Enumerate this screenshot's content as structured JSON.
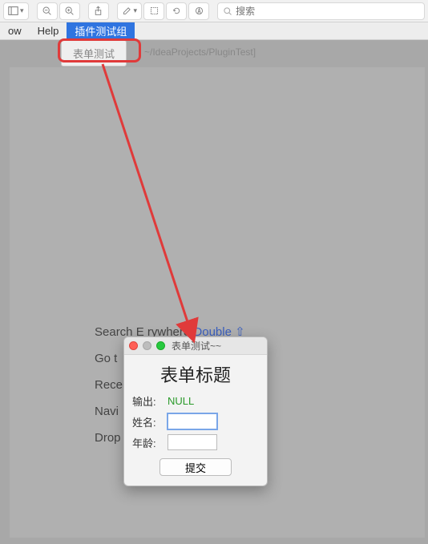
{
  "toolbar": {
    "search_placeholder": "搜索"
  },
  "menubar": {
    "items": [
      "ow",
      "Help",
      "插件测试组"
    ]
  },
  "submenu": {
    "label": "表单测试"
  },
  "pathbar": "~/IdeaProjects/PluginTest]",
  "welcome": {
    "line1_a": "Search E",
    "line1_b": "rywhere ",
    "line1_link": "Double ⇧",
    "line2": "Go t",
    "line3": "Rece",
    "line4": "Navi",
    "line5": "Drop"
  },
  "dialog": {
    "window_title": "表单测试~~",
    "title": "表单标题",
    "output_label": "输出:",
    "output_value": "NULL",
    "name_label": "姓名:",
    "name_value": "",
    "age_label": "年龄:",
    "age_value": "",
    "submit_label": "提交"
  }
}
